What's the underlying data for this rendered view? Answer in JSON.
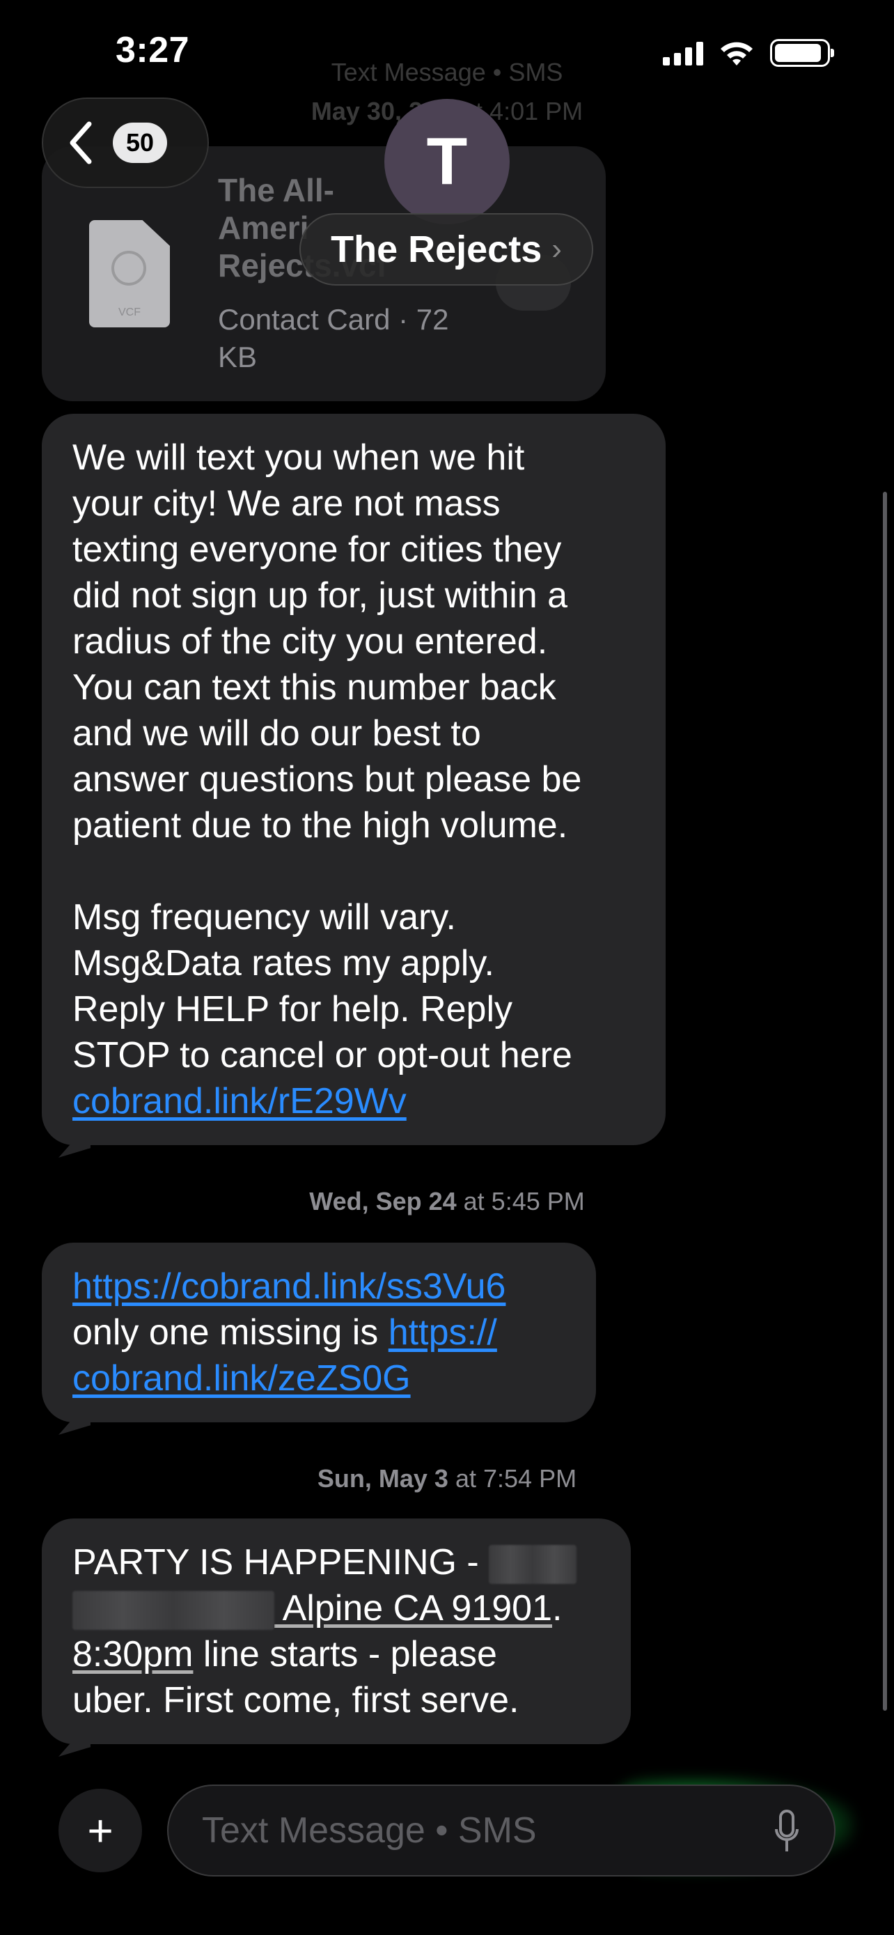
{
  "status_bar": {
    "time": "3:27"
  },
  "faded_header": {
    "line1": "Text Message • SMS",
    "line2_bold": "May 30, 20",
    "line2_rest": "…at 4:01 PM"
  },
  "nav": {
    "unread_count": "50",
    "contact_initial": "T",
    "contact_name": "The Rejects"
  },
  "vcf_card": {
    "file_label": "VCF",
    "title": "The All-American Rejects.vcf",
    "title_lines": [
      "The All-",
      "Ameri",
      "Rejects.vcf"
    ],
    "meta_line1": "Contact Card · 72",
    "meta_line2": "KB"
  },
  "messages": [
    {
      "lines": [
        "We will text you when we hit",
        "your city! We are not mass",
        "texting everyone for cities they",
        "did not sign up for,  just within a",
        "radius of the city you entered.",
        "You can text this number back",
        "and we will do our best to",
        "answer questions but please be",
        "patient due to the high volume."
      ],
      "lines2": [
        "Msg frequency will vary.",
        "Msg&Data rates my apply.",
        "Reply HELP for help. Reply",
        "STOP to cancel or opt-out here"
      ],
      "link": "cobrand.link/rE29Wv"
    },
    {
      "timestamp_bold": "Wed, Sep 24",
      "timestamp_rest": " at 5:45 PM",
      "link1": "https://cobrand.link/ss3Vu6",
      "text": "only one missing is ",
      "link2a": "https://",
      "link2b": "cobrand.link/zeZS0G"
    },
    {
      "timestamp_bold": "Sun, May 3",
      "timestamp_rest": " at 7:54 PM",
      "line1": "PARTY IS HAPPENING - ",
      "address_tail": " Alpine CA 91901",
      "period": ".",
      "time_link": "8:30pm",
      "line3_rest": " line starts - please",
      "line4": "uber. First come, first serve."
    }
  ],
  "composer": {
    "placeholder": "Text Message • SMS"
  },
  "colors": {
    "bubble": "#262628",
    "link": "#2a8cff",
    "send_glow": "#15b23e"
  }
}
